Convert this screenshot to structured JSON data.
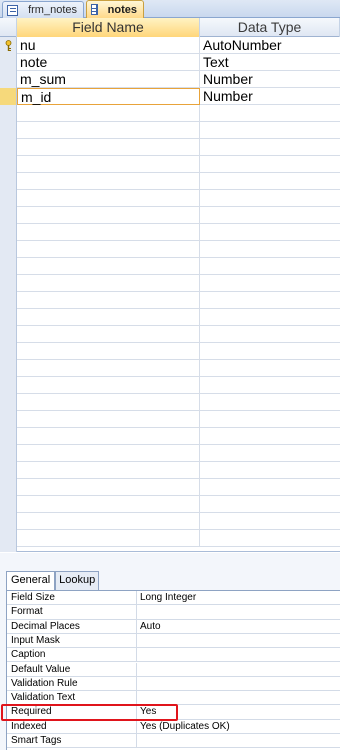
{
  "tabs": [
    {
      "label": "frm_notes",
      "icon": "form-icon",
      "active": false
    },
    {
      "label": "notes",
      "icon": "table-icon",
      "active": true
    }
  ],
  "grid": {
    "headers": {
      "field_name": "Field Name",
      "data_type": "Data Type"
    },
    "rows": [
      {
        "field": "nu",
        "type": "AutoNumber",
        "primary_key": true
      },
      {
        "field": "note",
        "type": "Text"
      },
      {
        "field": "m_sum",
        "type": "Number"
      },
      {
        "field": "m_id",
        "type": "Number",
        "current": true
      }
    ]
  },
  "properties": {
    "tabs": [
      "General",
      "Lookup"
    ],
    "rows": [
      {
        "label": "Field Size",
        "value": "Long Integer"
      },
      {
        "label": "Format",
        "value": ""
      },
      {
        "label": "Decimal Places",
        "value": "Auto"
      },
      {
        "label": "Input Mask",
        "value": ""
      },
      {
        "label": "Caption",
        "value": ""
      },
      {
        "label": "Default Value",
        "value": ""
      },
      {
        "label": "Validation Rule",
        "value": ""
      },
      {
        "label": "Validation Text",
        "value": ""
      },
      {
        "label": "Required",
        "value": "Yes"
      },
      {
        "label": "Indexed",
        "value": "Yes (Duplicates OK)"
      },
      {
        "label": "Smart Tags",
        "value": ""
      }
    ]
  },
  "colors": {
    "highlight": "#e0141b",
    "active_tab": "#ffd98a"
  }
}
